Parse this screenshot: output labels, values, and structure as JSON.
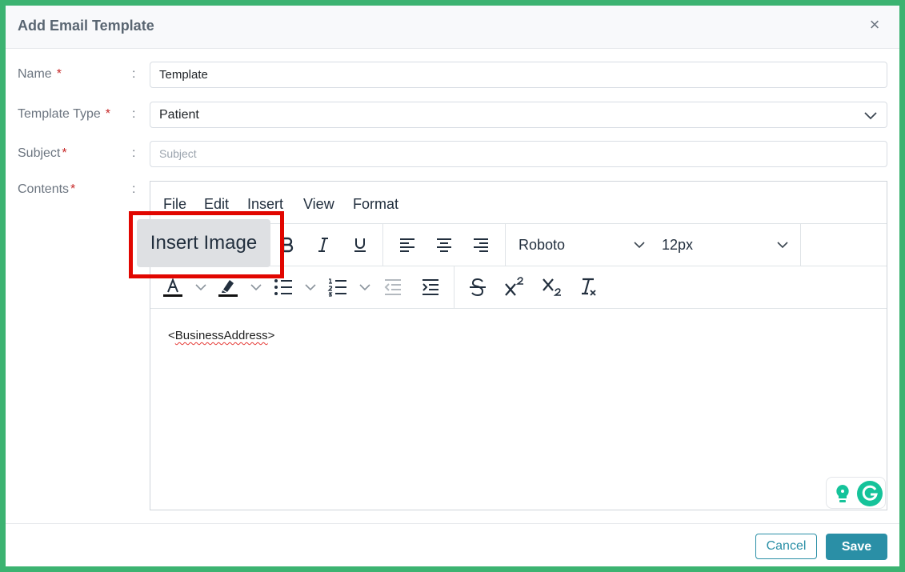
{
  "dialog": {
    "title": "Add Email Template",
    "close_glyph": "×"
  },
  "form": {
    "colon": ":",
    "required_mark": "*",
    "name": {
      "label": "Name",
      "value": "Template"
    },
    "template_type": {
      "label": "Template Type",
      "value": "Patient"
    },
    "subject": {
      "label": "Subject",
      "value": "",
      "placeholder": "Subject"
    },
    "contents": {
      "label": "Contents"
    }
  },
  "editor": {
    "menu": [
      "File",
      "Edit",
      "Insert",
      "View",
      "Format"
    ],
    "font_family": "Roboto",
    "font_size": "12px",
    "body_prefix": "<",
    "body_word": "BusinessAddress",
    "body_suffix": ">",
    "tooltip": "Insert Image",
    "toolbar_icons": [
      "bold-icon",
      "italic-icon",
      "underline-icon",
      "align-left-icon",
      "align-center-icon",
      "align-right-icon",
      "text-color-icon",
      "highlight-color-icon",
      "bullet-list-icon",
      "numbered-list-icon",
      "outdent-icon",
      "indent-icon",
      "strikethrough-icon",
      "superscript-icon",
      "subscript-icon",
      "clear-formatting-icon"
    ]
  },
  "footer": {
    "cancel_label": "Cancel",
    "save_label": "Save"
  },
  "colors": {
    "frame_border": "#3cb371",
    "accent": "#2a8fa6",
    "required": "#c62828",
    "highlight_box": "#e10600",
    "grammarly": "#15c39a"
  }
}
